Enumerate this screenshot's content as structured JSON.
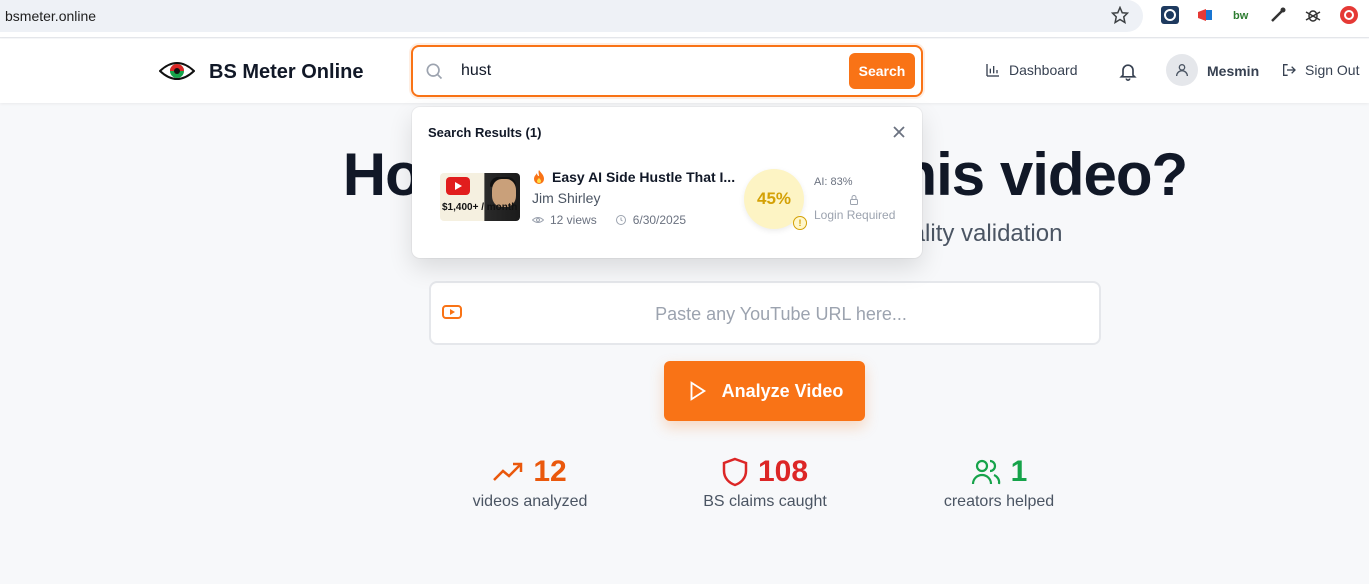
{
  "browser": {
    "url": "bsmeter.online",
    "extensions": [
      "blue-square-extension-icon",
      "megaphone-extension-icon",
      "bw-extension-icon",
      "eyedropper-extension-icon",
      "bug-extension-icon",
      "red-circle-extension-icon"
    ]
  },
  "header": {
    "app_title": "BS Meter Online",
    "search_value": "hust",
    "search_button": "Search",
    "dashboard": "Dashboard",
    "user_name": "Mesmin",
    "sign_out": "Sign Out",
    "accent": "#f97316"
  },
  "hero": {
    "title": "How much BS is in this video?",
    "subtitle": "AI-powered fact-checking & bs-o-meter reality validation",
    "url_placeholder": "Paste any YouTube URL here...",
    "analyze_button": "Analyze Video"
  },
  "stats": [
    {
      "value": "12",
      "label": "videos analyzed",
      "color": "#ea580c"
    },
    {
      "value": "108",
      "label": "BS claims caught",
      "color": "#dc2626"
    },
    {
      "value": "1",
      "label": "creators helped",
      "color": "#16a34a"
    }
  ],
  "search_results": {
    "title": "Search Results (1)",
    "items": [
      {
        "thumb_text": "$1,400+ / month",
        "title": "Easy AI Side Hustle That I...",
        "author": "Jim Shirley",
        "views": "12 views",
        "date": "6/30/2025",
        "score": "45%",
        "ai": "AI: 83%",
        "login": "Login Required"
      }
    ]
  }
}
